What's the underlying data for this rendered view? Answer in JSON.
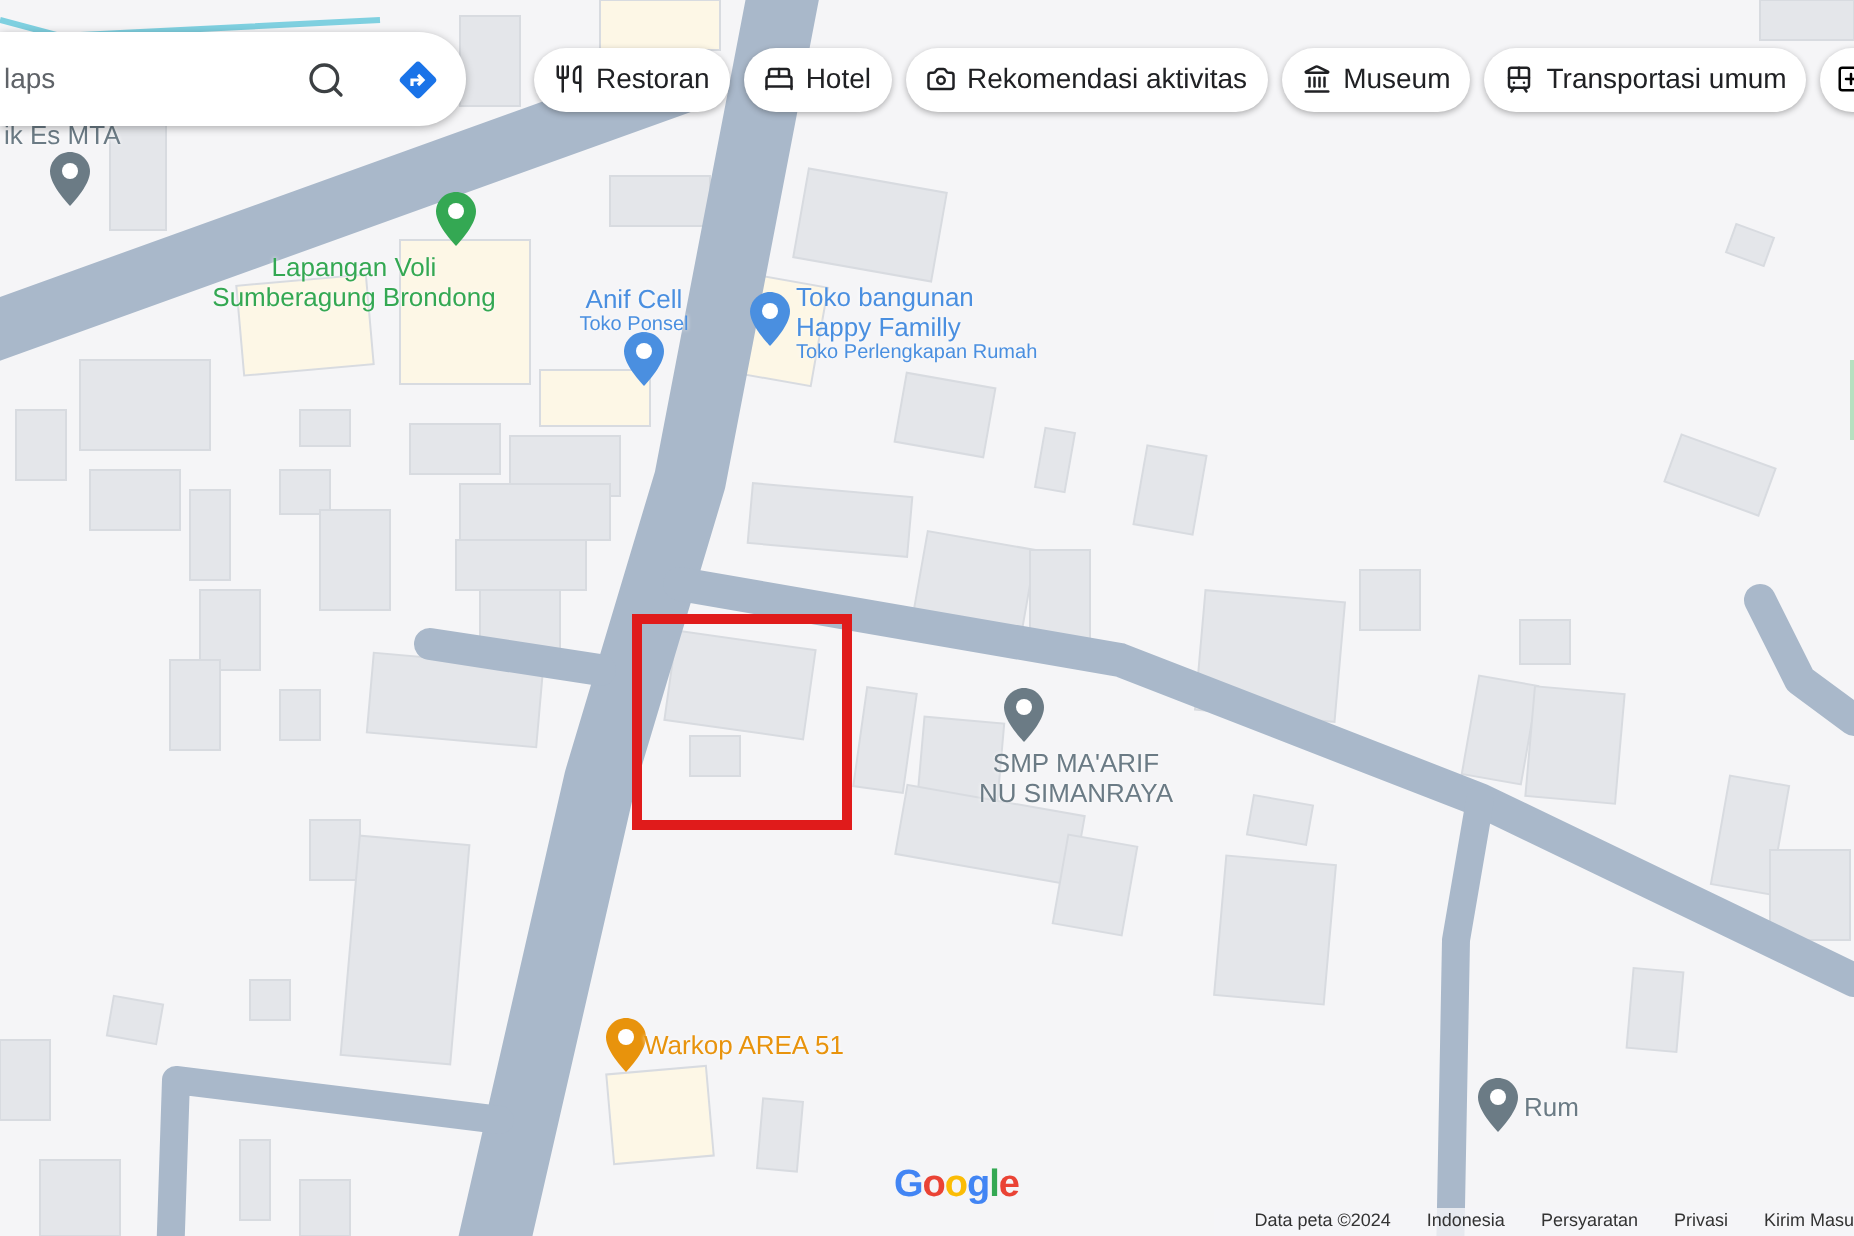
{
  "search": {
    "placeholder": "laps"
  },
  "chips": [
    {
      "label": "Restoran",
      "kind": "restaurant"
    },
    {
      "label": "Hotel",
      "kind": "hotel"
    },
    {
      "label": "Rekomendasi aktivitas",
      "kind": "camera"
    },
    {
      "label": "Museum",
      "kind": "museum"
    },
    {
      "label": "Transportasi umum",
      "kind": "transit"
    }
  ],
  "places": [
    {
      "name": "ik Es MTA",
      "color": "#6b7b85"
    },
    {
      "name": "Lapangan Voli Sumberagung Brondong",
      "color": "#34a853"
    },
    {
      "name": "Anif Cell",
      "subtitle": "Toko Ponsel",
      "color": "#4a8fe0"
    },
    {
      "name": "Toko bangunan Happy Familly",
      "subtitle": "Toko Perlengkapan Rumah",
      "color": "#4a8fe0"
    },
    {
      "name": "SMP MA'ARIF NU SIMANRAYA",
      "color": "#6b7b85"
    },
    {
      "name": "Warkop AREA 51",
      "color": "#e8930c"
    },
    {
      "name": "Rum",
      "color": "#6b7b85"
    }
  ],
  "logo": "Google",
  "footer": [
    "Data peta ©2024",
    "Indonesia",
    "Persyaratan",
    "Privasi",
    "Kirim Masu"
  ]
}
